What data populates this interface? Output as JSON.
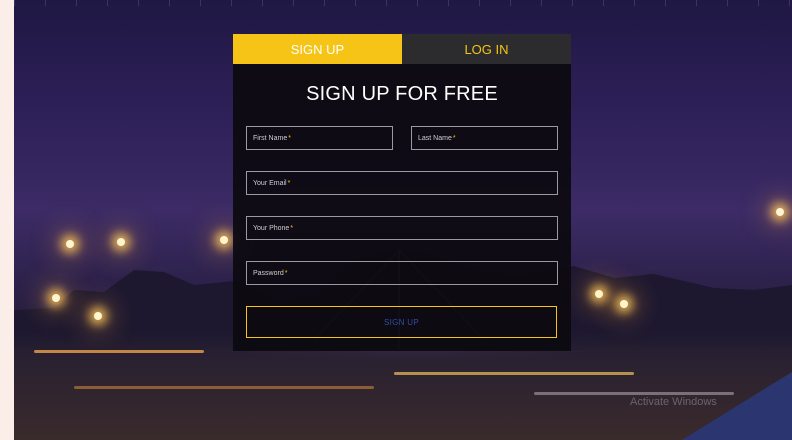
{
  "tabs": {
    "signup": "SIGN UP",
    "login": "LOG IN"
  },
  "form": {
    "heading": "SIGN UP FOR FREE",
    "fields": {
      "first_name": "First Name",
      "last_name": "Last Name",
      "email": "Your Email",
      "phone": "Your Phone",
      "password": "Password"
    },
    "required_marker": "*",
    "submit_label": "SIGN UP"
  },
  "watermark": "Activate Windows",
  "colors": {
    "accent": "#f6c416",
    "panel": "#0c0a10",
    "tab_inactive": "#2c2c2e"
  }
}
